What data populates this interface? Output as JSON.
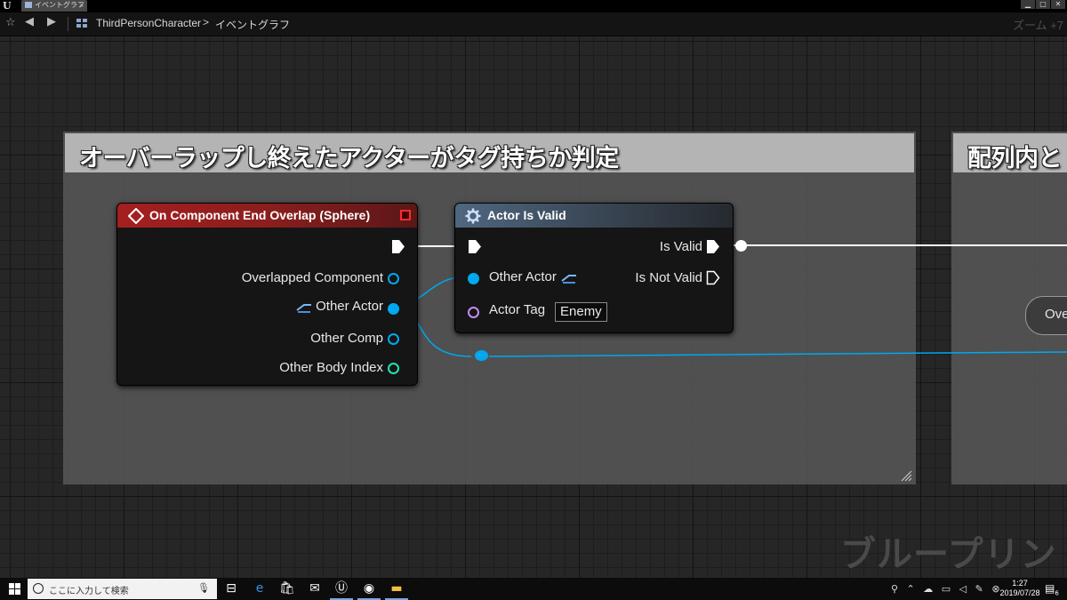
{
  "window": {
    "tab_label": "イベントグラフ",
    "logo": "U"
  },
  "toolbar": {
    "breadcrumb_root": "ThirdPersonCharacter",
    "breadcrumb_separator": ">",
    "breadcrumb_current": "イベントグラフ",
    "zoom": "ズーム +7"
  },
  "comments": [
    {
      "title": "オーバーラップし終えたアクターがタグ持ちか判定"
    },
    {
      "title": "配列内と"
    }
  ],
  "nodes": {
    "overlap_event": {
      "title": "On Component End Overlap (Sphere)",
      "pins": [
        "Overlapped Component",
        "Other Actor",
        "Other Comp",
        "Other Body Index"
      ],
      "header_color": "#8b1e1e"
    },
    "actor_is_valid": {
      "title": "Actor Is Valid",
      "inputs": [
        "Other Actor",
        "Actor Tag"
      ],
      "outputs": [
        "Is Valid",
        "Is Not Valid"
      ],
      "actor_tag_value": "Enemy"
    },
    "right_partial": {
      "label": "Ove"
    }
  },
  "pin_colors": {
    "object": "#00a8f0",
    "exec": "#ffffff",
    "int": "#1fe3b0",
    "name": "#c58cf0"
  },
  "watermark": "ブループリント",
  "taskbar": {
    "search_placeholder": "ここに入力して検索",
    "clock_time": "1:27",
    "clock_date": "2019/07/28",
    "notification_count": "6"
  }
}
